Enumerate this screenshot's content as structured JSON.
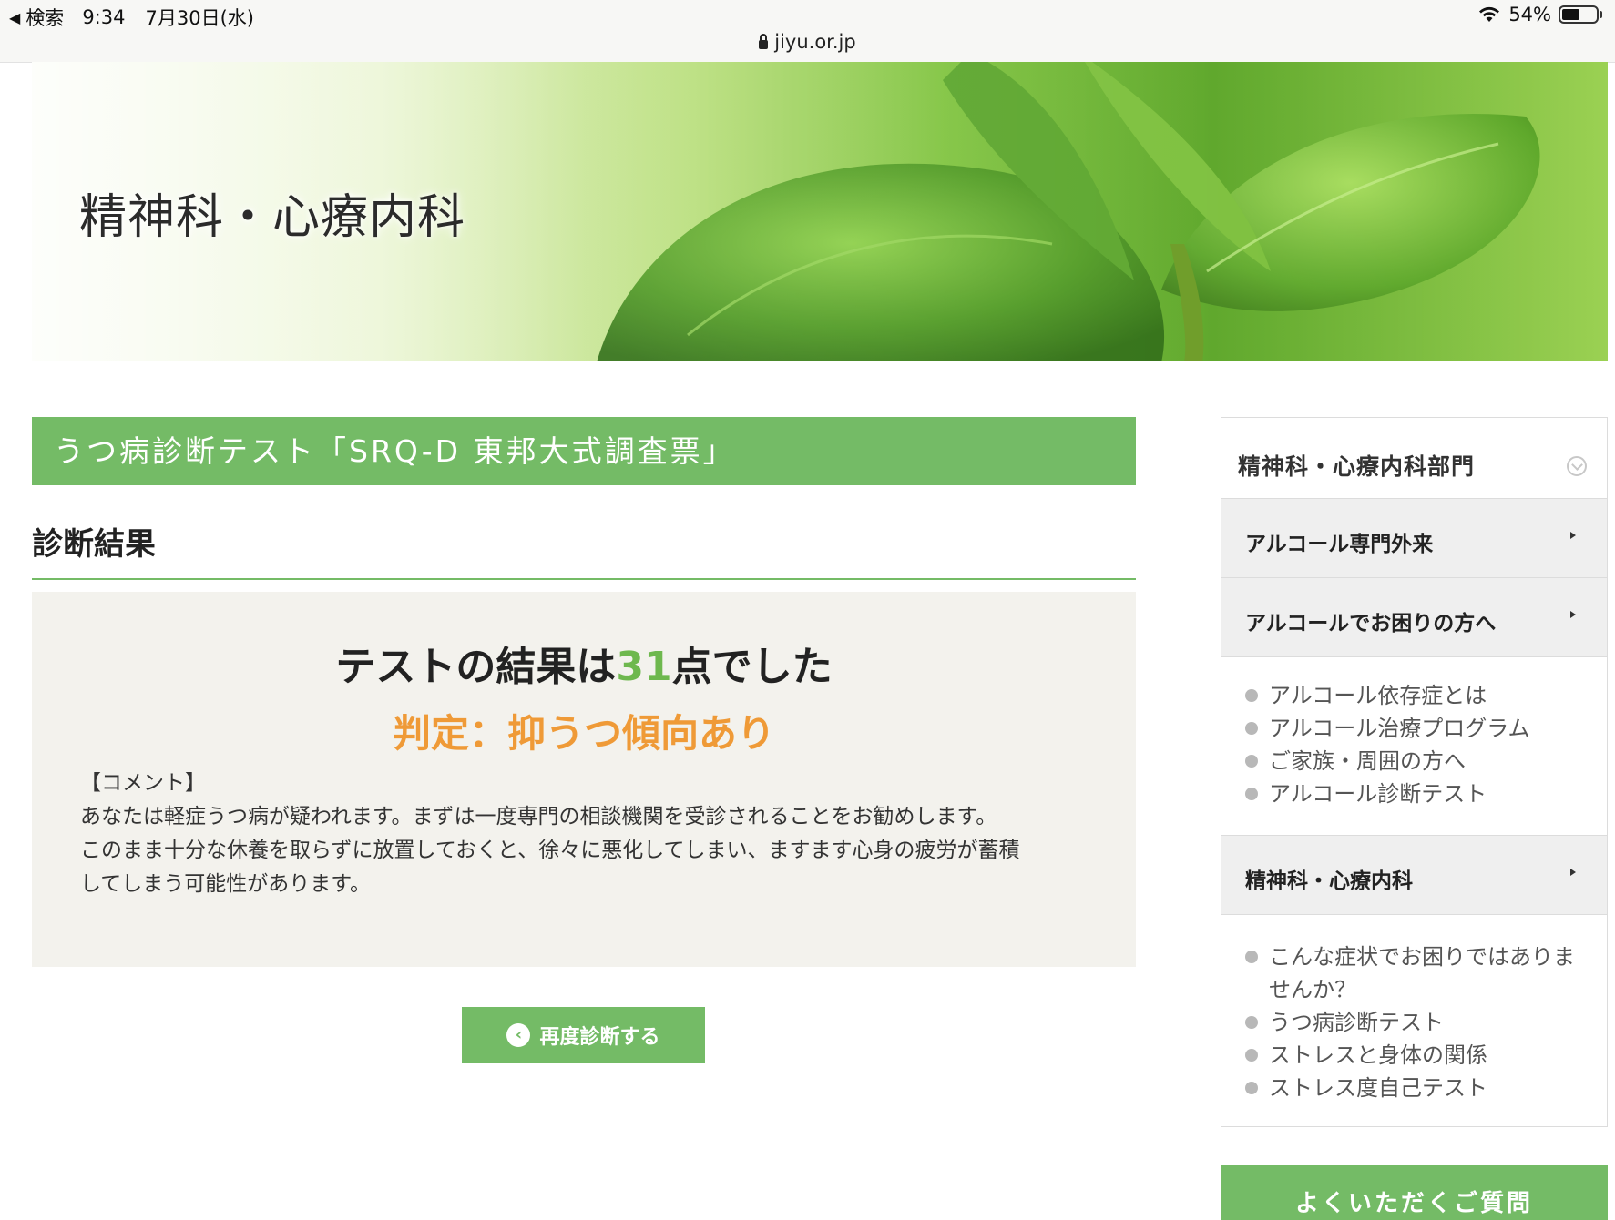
{
  "statusbar": {
    "back_label": "検索",
    "time": "9:34",
    "date": "7月30日(水)",
    "battery": "54%",
    "battery_level": 0.54,
    "url": "jiyu.or.jp"
  },
  "hero": {
    "title": "精神科・心療内科"
  },
  "main": {
    "section_title": "うつ病診断テスト「SRQ-D 東邦大式調査票」",
    "result_heading": "診断結果",
    "score_prefix": "テストの結果は",
    "score": "31",
    "score_suffix": "点でした",
    "verdict": "判定：抑うつ傾向あり",
    "comment_label": "【コメント】",
    "comment_lines": [
      "あなたは軽症うつ病が疑われます。まずは一度専門の相談機関を受診されることをお勧めします。",
      "このまま十分な休養を取らずに放置しておくと、徐々に悪化してしまい、ますます心身の疲労が蓄積",
      "してしまう可能性があります。"
    ],
    "retry_label": "再度診断する"
  },
  "sidebar": {
    "title": "精神科・心療内科部門",
    "categories": [
      {
        "label": "アルコール専門外来"
      },
      {
        "label": "アルコールでお困りの方へ"
      }
    ],
    "alcohol_links": [
      "アルコール依存症とは",
      "アルコール治療プログラム",
      "ご家族・周囲の方へ",
      "アルコール診断テスト"
    ],
    "psych_category": "精神科・心療内科",
    "psych_links": [
      "こんな症状でお困りではありま",
      "せんか？",
      "うつ病診断テスト",
      "ストレスと身体の関係",
      "ストレス度自己テスト"
    ],
    "faq_label": "よくいただくご質問"
  },
  "colors": {
    "accent_green": "#74bb66",
    "score_green": "#6eb84e",
    "verdict_orange": "#ef9a37",
    "result_bg": "#f3f2ed"
  },
  "icons": [
    "back-triangle-icon",
    "wifi-icon",
    "battery-icon",
    "lock-icon",
    "chevron-down-circle-icon",
    "chevron-right-icon",
    "bullet-dot-icon",
    "chevron-left-circle-icon"
  ]
}
